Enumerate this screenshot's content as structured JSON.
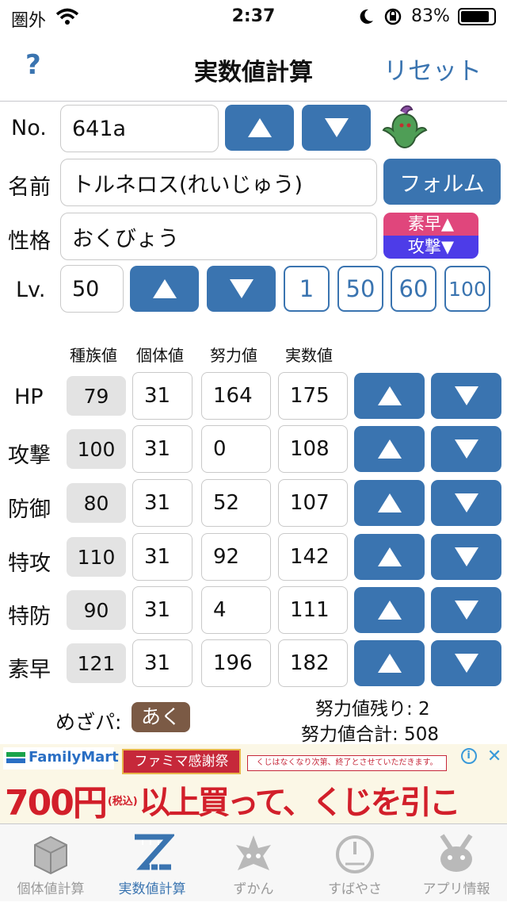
{
  "status_bar": {
    "carrier": "圏外",
    "time": "2:37",
    "battery": "83%"
  },
  "nav": {
    "help": "?",
    "title": "実数値計算",
    "reset": "リセット"
  },
  "form": {
    "no_label": "No.",
    "no_value": "641a",
    "name_label": "名前",
    "name_value": "トルネロス(れいじゅう)",
    "form_button": "フォルム",
    "nature_label": "性格",
    "nature_value": "おくびょう",
    "nature_up": "素早▲",
    "nature_down": "攻撃▼",
    "up_color": "#e0467c",
    "down_color": "#4d3ce8",
    "lv_label": "Lv.",
    "lv_value": "50",
    "lv_presets": [
      "1",
      "50",
      "60",
      "100"
    ]
  },
  "stats": {
    "headers": [
      "種族値",
      "個体値",
      "努力値",
      "実数値"
    ],
    "rows": [
      {
        "name": "HP",
        "base": "79",
        "iv": "31",
        "ev": "164",
        "real": "175"
      },
      {
        "name": "攻撃",
        "base": "100",
        "iv": "31",
        "ev": "0",
        "real": "108"
      },
      {
        "name": "防御",
        "base": "80",
        "iv": "31",
        "ev": "52",
        "real": "107"
      },
      {
        "name": "特攻",
        "base": "110",
        "iv": "31",
        "ev": "92",
        "real": "142"
      },
      {
        "name": "特防",
        "base": "90",
        "iv": "31",
        "ev": "4",
        "real": "111"
      },
      {
        "name": "素早",
        "base": "121",
        "iv": "31",
        "ev": "196",
        "real": "182"
      }
    ]
  },
  "footer": {
    "hidden_power_label": "めざパ:",
    "hidden_power_type": "あく",
    "hidden_power_color": "#7b5a45",
    "ev_remaining": "努力値残り: 2",
    "ev_total": "努力値合計: 508"
  },
  "ad": {
    "brand": "FamilyMart",
    "campaign": "ファミマ感謝祭",
    "notice": "くじはなくなり次第、終了とさせていただきます。",
    "tax_note": "(税込)",
    "headline_amount": "700円",
    "headline_rest": "以上買って、くじを引こう!"
  },
  "tabs": [
    {
      "label": "個体値計算",
      "icon": "cube-icon",
      "active": false
    },
    {
      "label": "実数値計算",
      "icon": "ruler-z-icon",
      "active": true
    },
    {
      "label": "ずかん",
      "icon": "pokemon-icon",
      "active": false
    },
    {
      "label": "すばやさ",
      "icon": "speedometer-icon",
      "active": false
    },
    {
      "label": "アプリ情報",
      "icon": "pikachu-icon",
      "active": false
    }
  ]
}
